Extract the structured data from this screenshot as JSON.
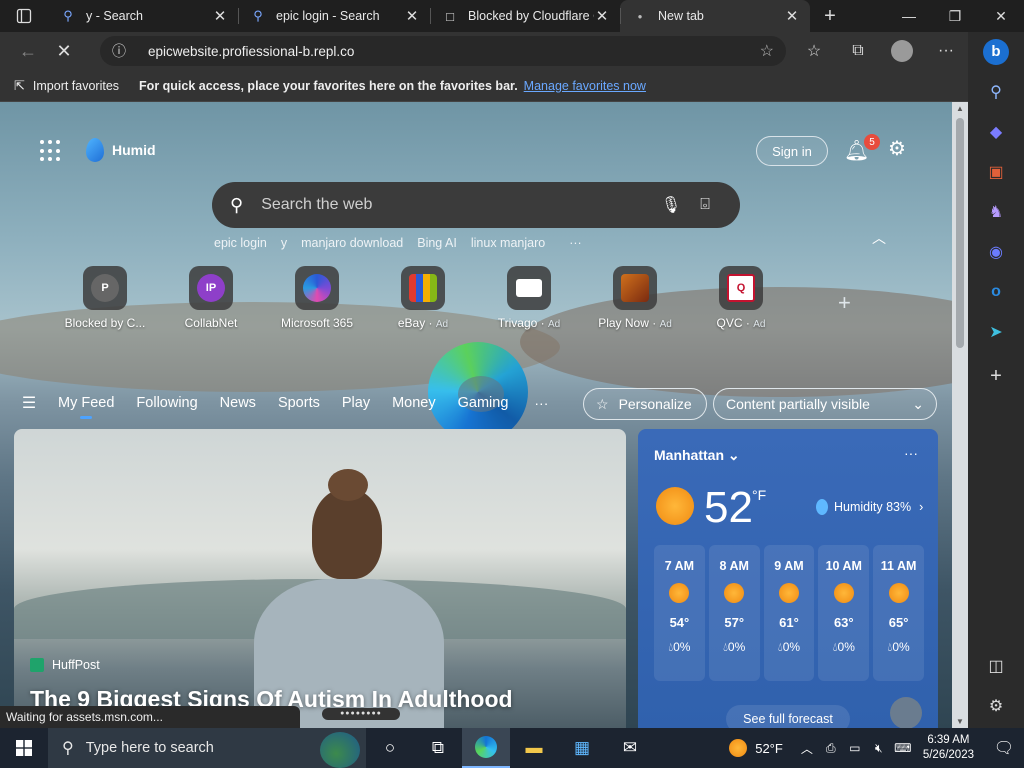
{
  "browser": {
    "tabs": [
      {
        "label": "y - Search",
        "icon": "search-icon",
        "active": false
      },
      {
        "label": "epic login - Search",
        "icon": "search-icon",
        "active": false
      },
      {
        "label": "Blocked by Cloudflare C",
        "icon": "document-icon",
        "active": false
      },
      {
        "label": "New tab",
        "icon": "loading-dot-icon",
        "active": true
      }
    ],
    "address": {
      "url": "epicwebsite.profiessional-b.repl.co"
    },
    "favorites_bar": {
      "import_label": "Import favorites",
      "message": "For quick access, place your favorites here on the favorites bar.",
      "link": "Manage favorites now"
    },
    "status_text": "Waiting for assets.msn.com..."
  },
  "newtab": {
    "brand": "Humid",
    "signin": "Sign in",
    "notification_count": "5",
    "search": {
      "placeholder": "Search the web"
    },
    "recent_searches": [
      "epic login",
      "y",
      "manjaro download",
      "Bing AI",
      "linux manjaro"
    ],
    "quick_links": [
      {
        "label": "Blocked by C...",
        "initial": "P",
        "ad": "",
        "color": "#666666"
      },
      {
        "label": "CollabNet",
        "initial": "IP",
        "ad": "",
        "color": "#8e3fc9"
      },
      {
        "label": "Microsoft 365",
        "initial": "",
        "ad": "",
        "color": "#2a5ad6"
      },
      {
        "label": "eBay",
        "initial": "",
        "ad": "Ad",
        "color": "#e03a2f"
      },
      {
        "label": "Trivago",
        "initial": "",
        "ad": "Ad",
        "color": "#ffffff"
      },
      {
        "label": "Play Now",
        "initial": "",
        "ad": "Ad",
        "color": "#b45a1c"
      },
      {
        "label": "QVC",
        "initial": "Q",
        "ad": "Ad",
        "color": "#ffffff"
      }
    ],
    "feed_tabs": [
      "My Feed",
      "Following",
      "News",
      "Sports",
      "Play",
      "Money",
      "Gaming"
    ],
    "personalize": "Personalize",
    "content_visibility": "Content partially visible",
    "hero": {
      "source": "HuffPost",
      "title": "The 9 Biggest Signs Of Autism In Adulthood"
    },
    "weather": {
      "location": "Manhattan",
      "temp": "52",
      "unit": "°F",
      "humidity": "Humidity 83%",
      "hours": [
        {
          "time": "7 AM",
          "temp": "54°",
          "precip": "0%"
        },
        {
          "time": "8 AM",
          "temp": "57°",
          "precip": "0%"
        },
        {
          "time": "9 AM",
          "temp": "61°",
          "precip": "0%"
        },
        {
          "time": "10 AM",
          "temp": "63°",
          "precip": "0%"
        },
        {
          "time": "11 AM",
          "temp": "65°",
          "precip": "0%"
        }
      ],
      "forecast_button": "See full forecast"
    }
  },
  "taskbar": {
    "search_placeholder": "Type here to search",
    "weather": "52°F",
    "time": "6:39 AM",
    "date": "5/26/2023"
  }
}
